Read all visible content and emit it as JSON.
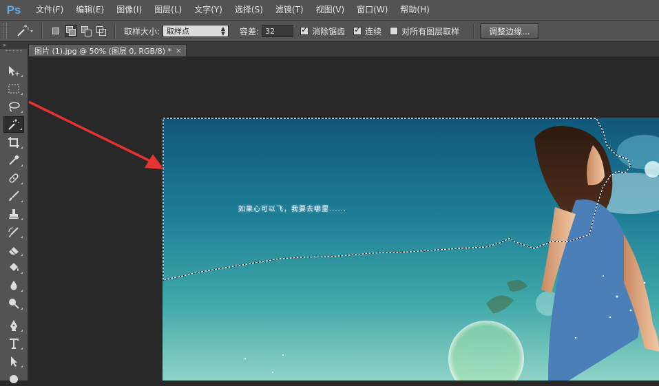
{
  "app": {
    "logo_text": "Ps",
    "accent": "#62a8e5"
  },
  "menu": {
    "items": [
      "文件(F)",
      "编辑(E)",
      "图像(I)",
      "图层(L)",
      "文字(Y)",
      "选择(S)",
      "滤镜(T)",
      "视图(V)",
      "窗口(W)",
      "帮助(H)"
    ]
  },
  "options": {
    "current_tool_icon": "magic-wand-icon",
    "sample_size_label": "取样大小:",
    "sample_size_value": "取样点",
    "tolerance_label": "容差:",
    "tolerance_value": "32",
    "anti_alias_label": "消除锯齿",
    "anti_alias_checked": true,
    "contiguous_label": "连续",
    "contiguous_checked": true,
    "sample_all_layers_label": "对所有图层取样",
    "sample_all_layers_checked": false,
    "refine_edge_label": "调整边缘..."
  },
  "document": {
    "tab_title": "图片 (1).jpg @ 50% (图层 0, RGB/8) *",
    "close_symbol": "×",
    "image_caption": "如果心可以飞，我要去哪里......"
  },
  "toolbar": {
    "tools": [
      "move-icon",
      "marquee-icon",
      "lasso-icon",
      "magic-wand-icon",
      "crop-icon",
      "eyedropper-icon",
      "healing-brush-icon",
      "brush-icon",
      "clone-stamp-icon",
      "history-brush-icon",
      "eraser-icon",
      "paint-bucket-icon",
      "blur-icon",
      "dodge-icon",
      "pen-icon",
      "type-icon",
      "path-selection-icon",
      "shape-icon"
    ],
    "active_tool": "magic-wand-icon"
  },
  "annotation": {
    "color": "#e63232"
  }
}
